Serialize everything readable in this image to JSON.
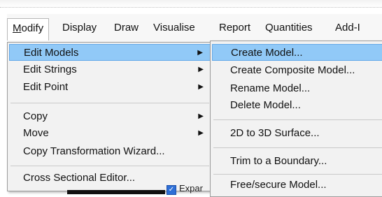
{
  "menubar": {
    "items": [
      "Modify",
      "Display",
      "Draw",
      "Visualise",
      "Report",
      "Quantities",
      "Add-I"
    ]
  },
  "modify_menu": {
    "items": [
      {
        "label": "Edit Models",
        "submenu": true,
        "highlighted": true
      },
      {
        "label": "Edit Strings",
        "submenu": true
      },
      {
        "label": "Edit Point",
        "submenu": true
      },
      {
        "label": "Copy",
        "submenu": true
      },
      {
        "label": "Move",
        "submenu": true
      },
      {
        "label": "Copy Transformation Wizard...",
        "submenu": false
      },
      {
        "label": "Cross Sectional Editor...",
        "submenu": false
      }
    ]
  },
  "edit_models_submenu": {
    "items": [
      {
        "label": "Create Model...",
        "highlighted": true
      },
      {
        "label": "Create Composite Model..."
      },
      {
        "label": "Rename Model..."
      },
      {
        "label": "Delete Model..."
      },
      {
        "label": "2D to 3D Surface..."
      },
      {
        "label": "Trim to a Boundary..."
      },
      {
        "label": "Free/secure Model..."
      }
    ]
  },
  "background": {
    "checkbox_label": "Expar",
    "checkbox_checked": true
  },
  "colors": {
    "highlight": "#91c9f7",
    "highlight_border": "#62a8e8",
    "menu_bg": "#f2f2f2"
  }
}
